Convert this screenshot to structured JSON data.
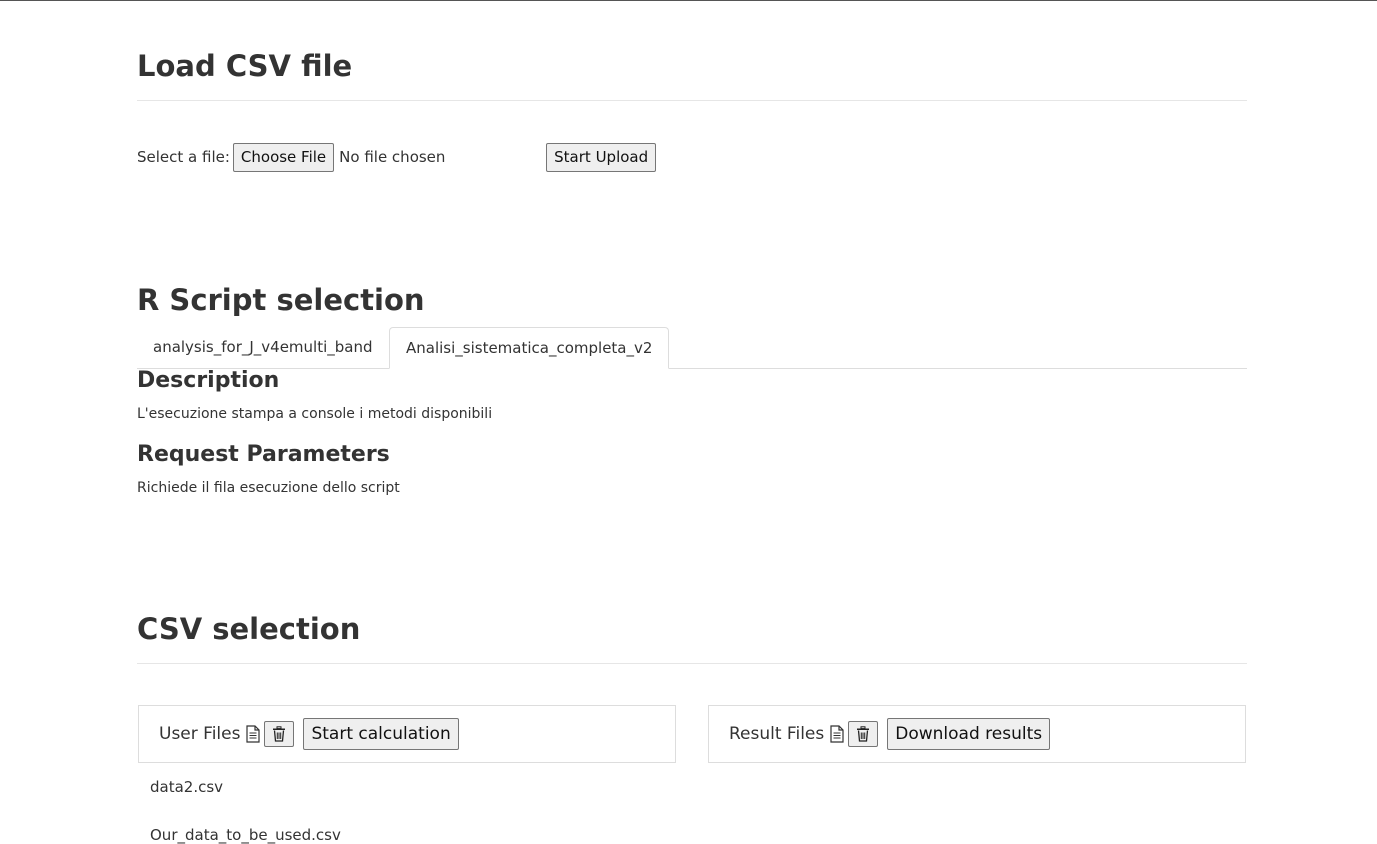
{
  "load_section": {
    "title": "Load CSV file",
    "select_label": "Select a file:",
    "choose_file_label": "Choose File",
    "no_file_text": "No file chosen",
    "start_upload_label": "Start Upload"
  },
  "script_section": {
    "title": "R Script selection",
    "tabs": [
      {
        "label": "analysis_for_J_v4emulti_band",
        "active": false
      },
      {
        "label": "Analisi_sistematica_completa_v2",
        "active": true
      }
    ],
    "description_heading": "Description",
    "description_text": "L'esecuzione stampa a console i metodi disponibili",
    "params_heading": "Request Parameters",
    "params_text": "Richiede il fila esecuzione dello script"
  },
  "csv_section": {
    "title": "CSV selection",
    "user_panel": {
      "label": "User Files",
      "action_label": "Start calculation",
      "files": [
        "data2.csv",
        "Our_data_to_be_used.csv"
      ]
    },
    "result_panel": {
      "label": "Result Files",
      "action_label": "Download results",
      "files": []
    }
  },
  "icons": {
    "file": "file-icon",
    "delete": "trash-icon"
  }
}
